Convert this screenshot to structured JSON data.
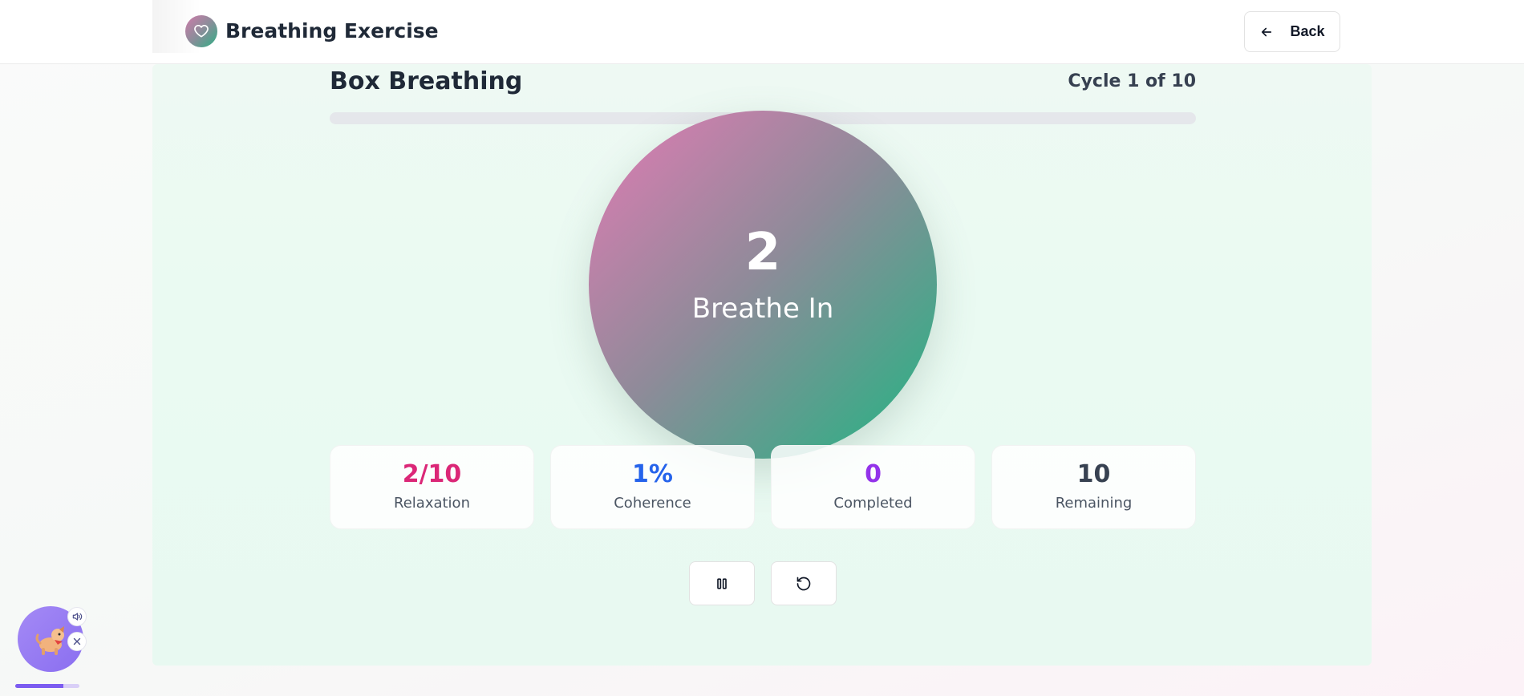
{
  "header": {
    "title": "Breathing Exercise",
    "back_label": "Back",
    "logo_icon": "heart-icon"
  },
  "exercise": {
    "title": "Box Breathing",
    "cycle_text": "Cycle 1 of 10",
    "progress": 0.0
  },
  "breath": {
    "count": "2",
    "phase": "Breathe In"
  },
  "stats": [
    {
      "value": "2/10",
      "label": "Relaxation",
      "color": "#db2777"
    },
    {
      "value": "1%",
      "label": "Coherence",
      "color": "#2563eb"
    },
    {
      "value": "0",
      "label": "Completed",
      "color": "#9333ea"
    },
    {
      "value": "10",
      "label": "Remaining",
      "color": "#374151"
    }
  ],
  "controls": {
    "pause_icon": "pause-icon",
    "restart_icon": "restart-icon"
  },
  "widget": {
    "mascot_icon": "dog-mascot-icon",
    "progress": 0.75
  },
  "colors": {
    "accent_pink": "#d36c9f",
    "accent_green": "#20b582"
  }
}
